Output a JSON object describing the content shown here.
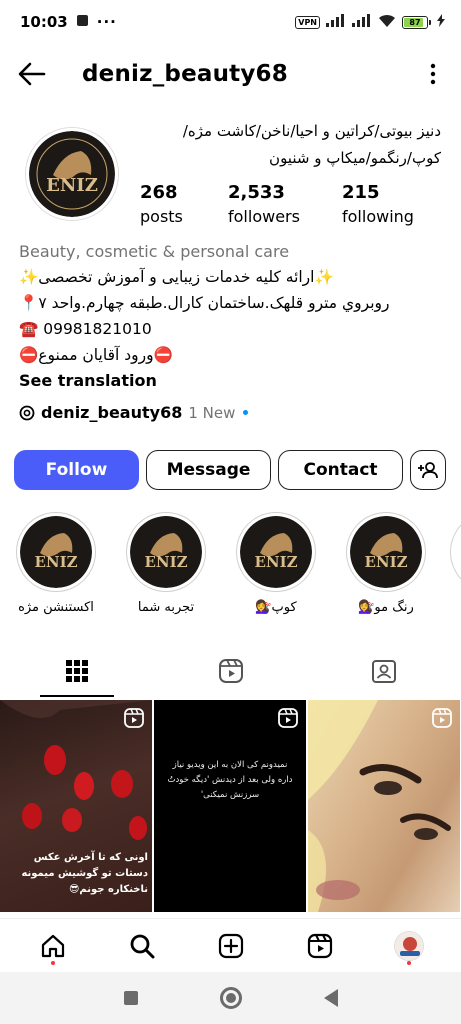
{
  "status_bar": {
    "time": "10:03",
    "vpn": "VPN",
    "battery": "87",
    "battery_percent": 87
  },
  "header": {
    "username": "deniz_beauty68",
    "back_icon": "arrow-left-icon",
    "more_icon": "vertical-dots-icon"
  },
  "profile": {
    "avatar_text": "ENIZ",
    "avatar_ring_text": "DENIZ BEAUTY SALON",
    "name_line1": "دنیز بیوتی/کراتین و احیا/ناخن/کاشت مژه/",
    "name_line2": "کوپ/رنگمو/میکاپ و شنیون",
    "stats": [
      {
        "value": "268",
        "label": "posts"
      },
      {
        "value": "2,533",
        "label": "followers"
      },
      {
        "value": "215",
        "label": "following"
      }
    ],
    "category": "Beauty, cosmetic & personal care",
    "bio_lines": [
      "✨ارائه کلیه خدمات زیبایی و آموزش تخصصی✨",
      "روبروي مترو قلهک.ساختمان کارال.طبقه چهارم.واحد ۷📍",
      "☎️ 09981821010",
      "⛔ورود آقایان ممنوع⛔"
    ],
    "see_translation": "See translation",
    "threads_name": "deniz_beauty68",
    "threads_badge": "1 New"
  },
  "actions": {
    "follow": "Follow",
    "message": "Message",
    "contact": "Contact"
  },
  "highlights": [
    {
      "label": "اکستنشن مژه"
    },
    {
      "label": "تجربه شما"
    },
    {
      "label": "کوپ💇‍♀️"
    },
    {
      "label": "رنگ مو💇‍♀️"
    }
  ],
  "tabs": [
    {
      "icon": "grid-icon",
      "active": true
    },
    {
      "icon": "reels-icon",
      "active": false
    },
    {
      "icon": "tagged-icon",
      "active": false
    }
  ],
  "posts": [
    {
      "caption": "اونی که تا آخرش عکس دستات تو گوشیش میمونه ناخنکاره جونم😎"
    },
    {
      "caption": "نمیدونم کی الان به این ویدیو نیاز داره ولی بعد از دیدنش 'دیگه خودتُ سرزنش نمیکنی'"
    },
    {
      "caption": ""
    }
  ],
  "bottom_nav": [
    {
      "icon": "home-icon"
    },
    {
      "icon": "search-icon"
    },
    {
      "icon": "create-icon"
    },
    {
      "icon": "reels-icon"
    },
    {
      "icon": "profile-avatar"
    }
  ],
  "colors": {
    "follow_blue": "#4a5df9",
    "category_gray": "#737373",
    "threads_dot": "#0095f6",
    "notif_red": "#ff3040"
  }
}
